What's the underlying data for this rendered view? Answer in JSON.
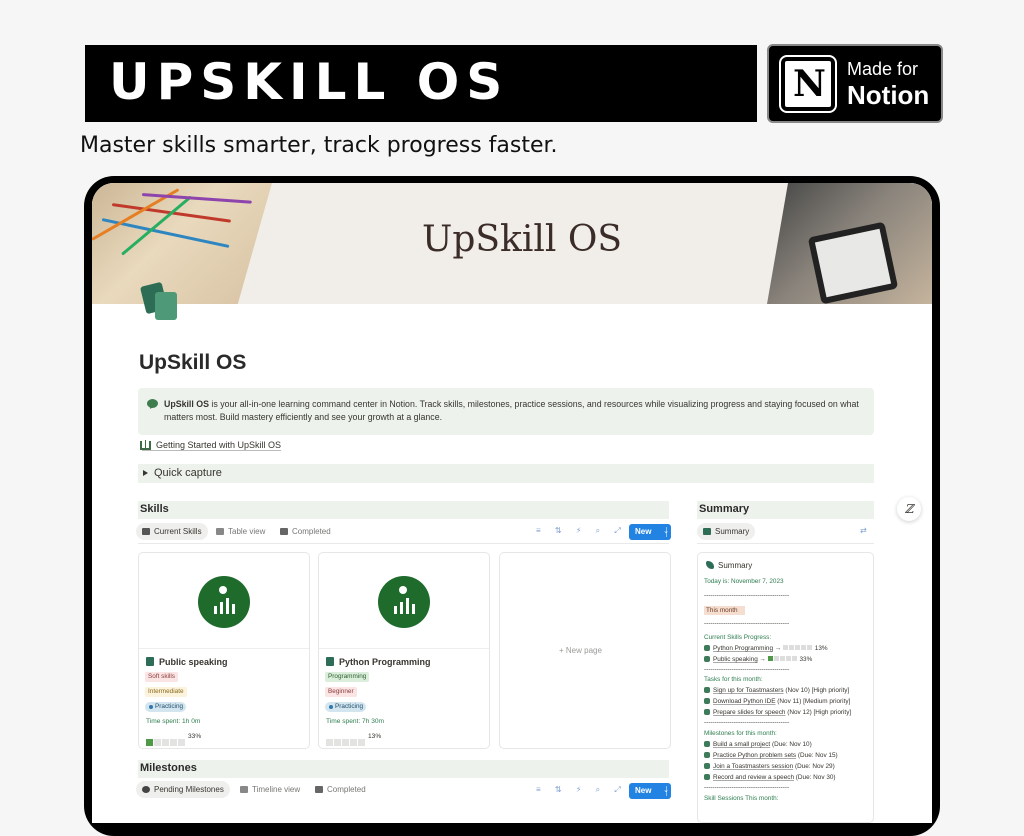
{
  "promo": {
    "title": "UPSKILL OS",
    "badge_line1": "Made for",
    "badge_line2": "Notion",
    "badge_logo": "N",
    "tagline": "Master skills smarter, track progress faster."
  },
  "page": {
    "cover_title": "UpSkill OS",
    "title": "UpSkill OS",
    "callout_bold": "UpSkill OS",
    "callout_text": " is your all-in-one learning command center in Notion. Track skills, milestones, practice sessions, and resources while visualizing progress and staying focused on what matters most. Build mastery efficiently and see your growth at a glance.",
    "getting_started": "Getting Started with UpSkill OS",
    "quick_capture": "Quick capture"
  },
  "skills": {
    "heading": "Skills",
    "tabs": [
      "Current Skills",
      "Table view",
      "Completed"
    ],
    "tools": "≡ ⇅ ⚡ ⌕ ⤢ ⇄",
    "new_label": "New",
    "new_chevron": "⌄",
    "new_page": "+ New page",
    "cards": [
      {
        "title": "Public speaking",
        "tags": [
          "Soft skills",
          "Intermediate"
        ],
        "status": "Practicing",
        "time": "Time spent: 1h 0m",
        "progress": 0.33,
        "progress_label": "33%"
      },
      {
        "title": "Python Programming",
        "tags": [
          "Programming",
          "Beginner"
        ],
        "status": "Practicing",
        "time": "Time spent: 7h 30m",
        "progress": 0.13,
        "progress_label": "13%"
      }
    ]
  },
  "summary": {
    "heading": "Summary",
    "tab": "Summary",
    "card_title": "Summary",
    "today": "Today is: November 7, 2023",
    "dashes": "----------------------------------------",
    "this_month": "This month",
    "progress_heading": "Current Skills Progress:",
    "progress": [
      {
        "name": "Python Programming",
        "arrow": "→",
        "progress": 0.13,
        "label": "13%"
      },
      {
        "name": "Public speaking",
        "arrow": "→",
        "progress": 0.33,
        "label": "33%"
      }
    ],
    "tasks_heading": "Tasks for this month:",
    "tasks": [
      {
        "name": "Sign up for Toastmasters",
        "meta": " (Nov 10) [High priority]"
      },
      {
        "name": "Download Python IDE",
        "meta": " (Nov 11) [Medium priority]"
      },
      {
        "name": "Prepare slides for speech",
        "meta": " (Nov 12) [High priority]"
      }
    ],
    "milestones_heading": "Milestones for this month:",
    "milestones": [
      {
        "name": "Build a small project",
        "meta": " (Due: Nov 10)"
      },
      {
        "name": "Practice Python problem sets",
        "meta": " (Due: Nov 15)"
      },
      {
        "name": "Join a Toastmasters session",
        "meta": " (Due: Nov 29)"
      },
      {
        "name": "Record and review a speech",
        "meta": " (Due: Nov 30)"
      }
    ],
    "sessions_heading": "Skill Sessions This month:"
  },
  "milestones": {
    "heading": "Milestones",
    "tabs": [
      "Pending Milestones",
      "Timeline view",
      "Completed"
    ],
    "tools": "≡ ⇅ ⚡ ⌕ ⤢ ⇄",
    "new_label": "New",
    "new_chevron": "⌄"
  },
  "float_button": "ℤ",
  "colors": {
    "accent_green": "#1e6b2c",
    "callout_bg": "#edf3ec",
    "button_blue": "#2383e2"
  }
}
